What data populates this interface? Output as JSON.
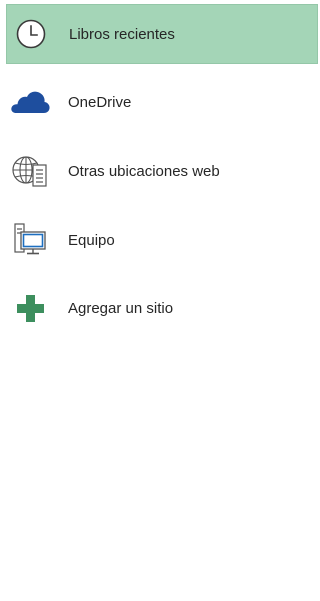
{
  "places": {
    "items": [
      {
        "label": "Libros recientes",
        "icon": "clock-icon",
        "selected": true
      },
      {
        "label": "OneDrive",
        "icon": "onedrive-cloud-icon",
        "selected": false
      },
      {
        "label": "Otras ubicaciones web",
        "icon": "globe-server-icon",
        "selected": false
      },
      {
        "label": "Equipo",
        "icon": "computer-icon",
        "selected": false
      },
      {
        "label": "Agregar un sitio",
        "icon": "plus-icon",
        "selected": false
      }
    ]
  },
  "colors": {
    "selected_background": "#a4d5b7",
    "onedrive_blue": "#1e4e9e",
    "plus_green": "#3d8f5e",
    "text": "#262626"
  }
}
